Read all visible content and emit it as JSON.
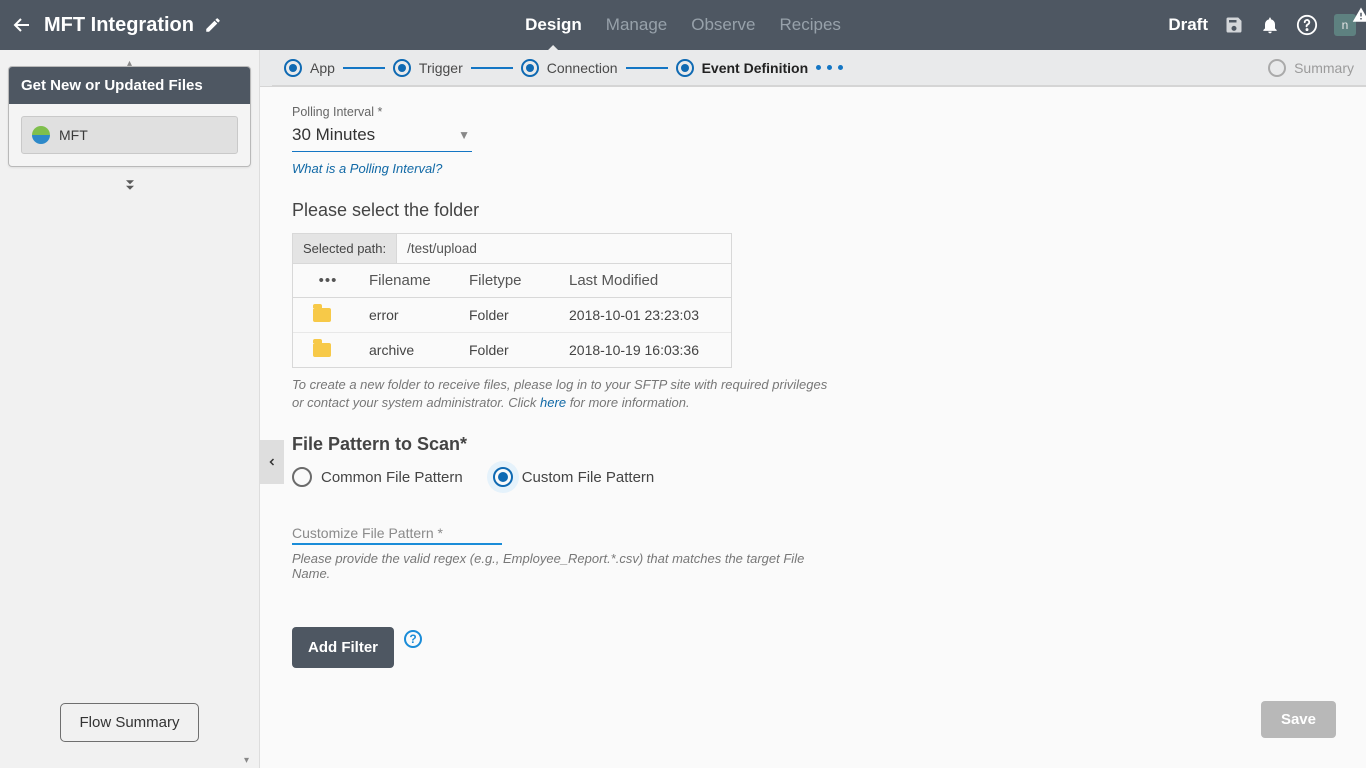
{
  "header": {
    "title": "MFT Integration",
    "tabs": [
      "Design",
      "Manage",
      "Observe",
      "Recipes"
    ],
    "active_tab": 0,
    "status": "Draft",
    "avatar_initial": "n"
  },
  "sidebar": {
    "card_title": "Get New or Updated Files",
    "items": [
      {
        "label": "MFT"
      }
    ],
    "flow_summary_btn": "Flow Summary"
  },
  "stepper": {
    "steps": [
      {
        "label": "App",
        "state": "done"
      },
      {
        "label": "Trigger",
        "state": "done"
      },
      {
        "label": "Connection",
        "state": "done"
      },
      {
        "label": "Event Definition",
        "state": "active"
      },
      {
        "label": "Summary",
        "state": "future"
      }
    ]
  },
  "polling": {
    "label": "Polling Interval",
    "value": "30 Minutes",
    "help_link": "What is a Polling Interval?"
  },
  "folder": {
    "section_title": "Please select the folder",
    "selected_path_label": "Selected path:",
    "selected_path": "/test/upload",
    "columns": [
      "",
      "Filename",
      "Filetype",
      "Last Modified"
    ],
    "rows": [
      {
        "filename": "error",
        "filetype": "Folder",
        "modified": "2018-10-01 23:23:03"
      },
      {
        "filename": "archive",
        "filetype": "Folder",
        "modified": "2018-10-19 16:03:36"
      }
    ],
    "note_pre": "To create a new folder to receive files, please log in to your SFTP site with required privileges or contact your system administrator. Click ",
    "note_link": "here",
    "note_post": " for more information."
  },
  "file_pattern": {
    "section_title": "File Pattern to Scan*",
    "options": [
      "Common File Pattern",
      "Custom File Pattern"
    ],
    "selected": 1,
    "customize_label": "Customize File Pattern *",
    "customize_hint": "Please provide the valid regex (e.g., Employee_Report.*.csv) that matches the target File Name."
  },
  "buttons": {
    "add_filter": "Add Filter",
    "save": "Save"
  }
}
